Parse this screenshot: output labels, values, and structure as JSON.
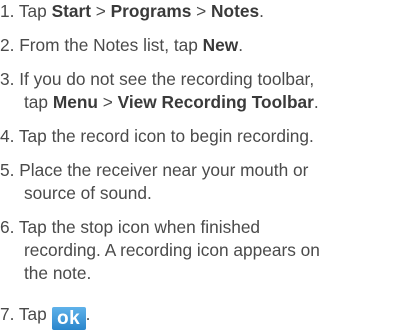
{
  "steps": [
    {
      "num": "1. ",
      "parts": [
        {
          "t": "Tap "
        },
        {
          "t": "Start",
          "b": true
        },
        {
          "t": " > "
        },
        {
          "t": "Programs",
          "b": true
        },
        {
          "t": " > "
        },
        {
          "t": "Notes",
          "b": true
        },
        {
          "t": "."
        }
      ]
    },
    {
      "num": "2. ",
      "parts": [
        {
          "t": "From the Notes list, tap "
        },
        {
          "t": "New",
          "b": true
        },
        {
          "t": "."
        }
      ]
    },
    {
      "num": "3. ",
      "line1": "If you do not see the recording toolbar,",
      "parts2": [
        {
          "t": "tap "
        },
        {
          "t": "Menu",
          "b": true
        },
        {
          "t": " > "
        },
        {
          "t": "View Recording Toolbar",
          "b": true
        },
        {
          "t": "."
        }
      ]
    },
    {
      "num": "4. ",
      "parts": [
        {
          "t": "Tap the record icon to begin recording."
        }
      ]
    },
    {
      "num": "5. ",
      "line1": "Place the receiver near your mouth or",
      "line2": "source of sound."
    },
    {
      "num": "6. ",
      "line1": "Tap the stop icon when finished",
      "line2": "recording. A recording icon appears on",
      "line3": "the note."
    },
    {
      "num": "7. ",
      "text_before_icon": "Tap ",
      "icon_label": "ok",
      "text_after_icon": "."
    }
  ]
}
